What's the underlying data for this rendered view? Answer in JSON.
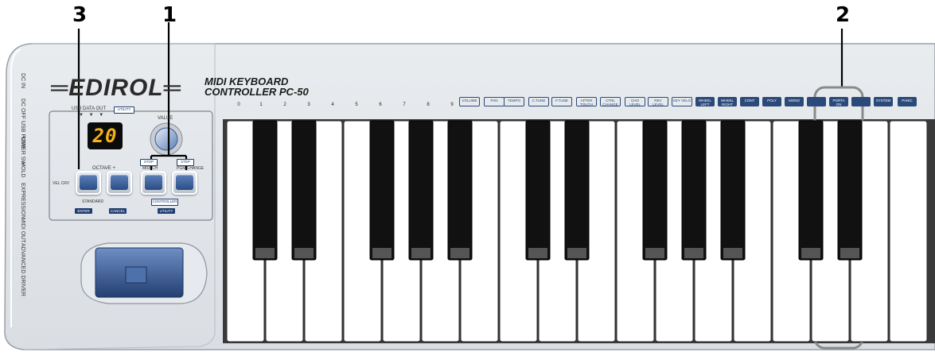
{
  "callouts": [
    "3",
    "1",
    "2"
  ],
  "brand": "EDIROL",
  "model_line1": "MIDI KEYBOARD",
  "model_line2": "CONTROLLER PC-50",
  "side_labels": [
    "DC IN",
    "DC OFF USB POWER SW",
    "USB",
    "HOLD",
    "EXPRESSION",
    "MIDI OUT",
    "ADVANCED DRIVER"
  ],
  "display_value": "20",
  "panel": {
    "usb_data_out": "USB  DATA OUT",
    "utility_tag": "UTILITY",
    "value_label": "VALUE",
    "octave_label": "OCTAVE  +",
    "vel_crv": "VEL CRV",
    "mix_label": "MIDI CH",
    "portch_label": "PGM CHANGE",
    "standard_label": "STANDARD",
    "controller_label": "CONTROLLER",
    "enter_tag": "ENTER",
    "cancel_tag": "CANCEL",
    "utility_tag2": "UTILITY"
  },
  "key_numbers": [
    "0",
    "1",
    "2",
    "3",
    "4",
    "5",
    "6",
    "7",
    "8",
    "9"
  ],
  "key_boxes": [
    "VOLUME",
    "PAN",
    "TEMPO",
    "C.TUNE",
    "F.TUNE",
    "AFTER TOUCH",
    "CTRL CHANGE",
    "CHO LEVEL",
    "REV LEVEL",
    "KEY VELO"
  ],
  "key_dark_boxes": [
    "WHEEL LEFT",
    "WHEEL RIGHT",
    "CONT",
    "POLY",
    "MONO",
    "",
    "PORTA ON",
    "",
    "SYSTEM",
    "PANIC"
  ],
  "colors": {
    "accent": "#1f3d70",
    "display": "#f4b21a",
    "highlight": "#8a8a8a"
  }
}
